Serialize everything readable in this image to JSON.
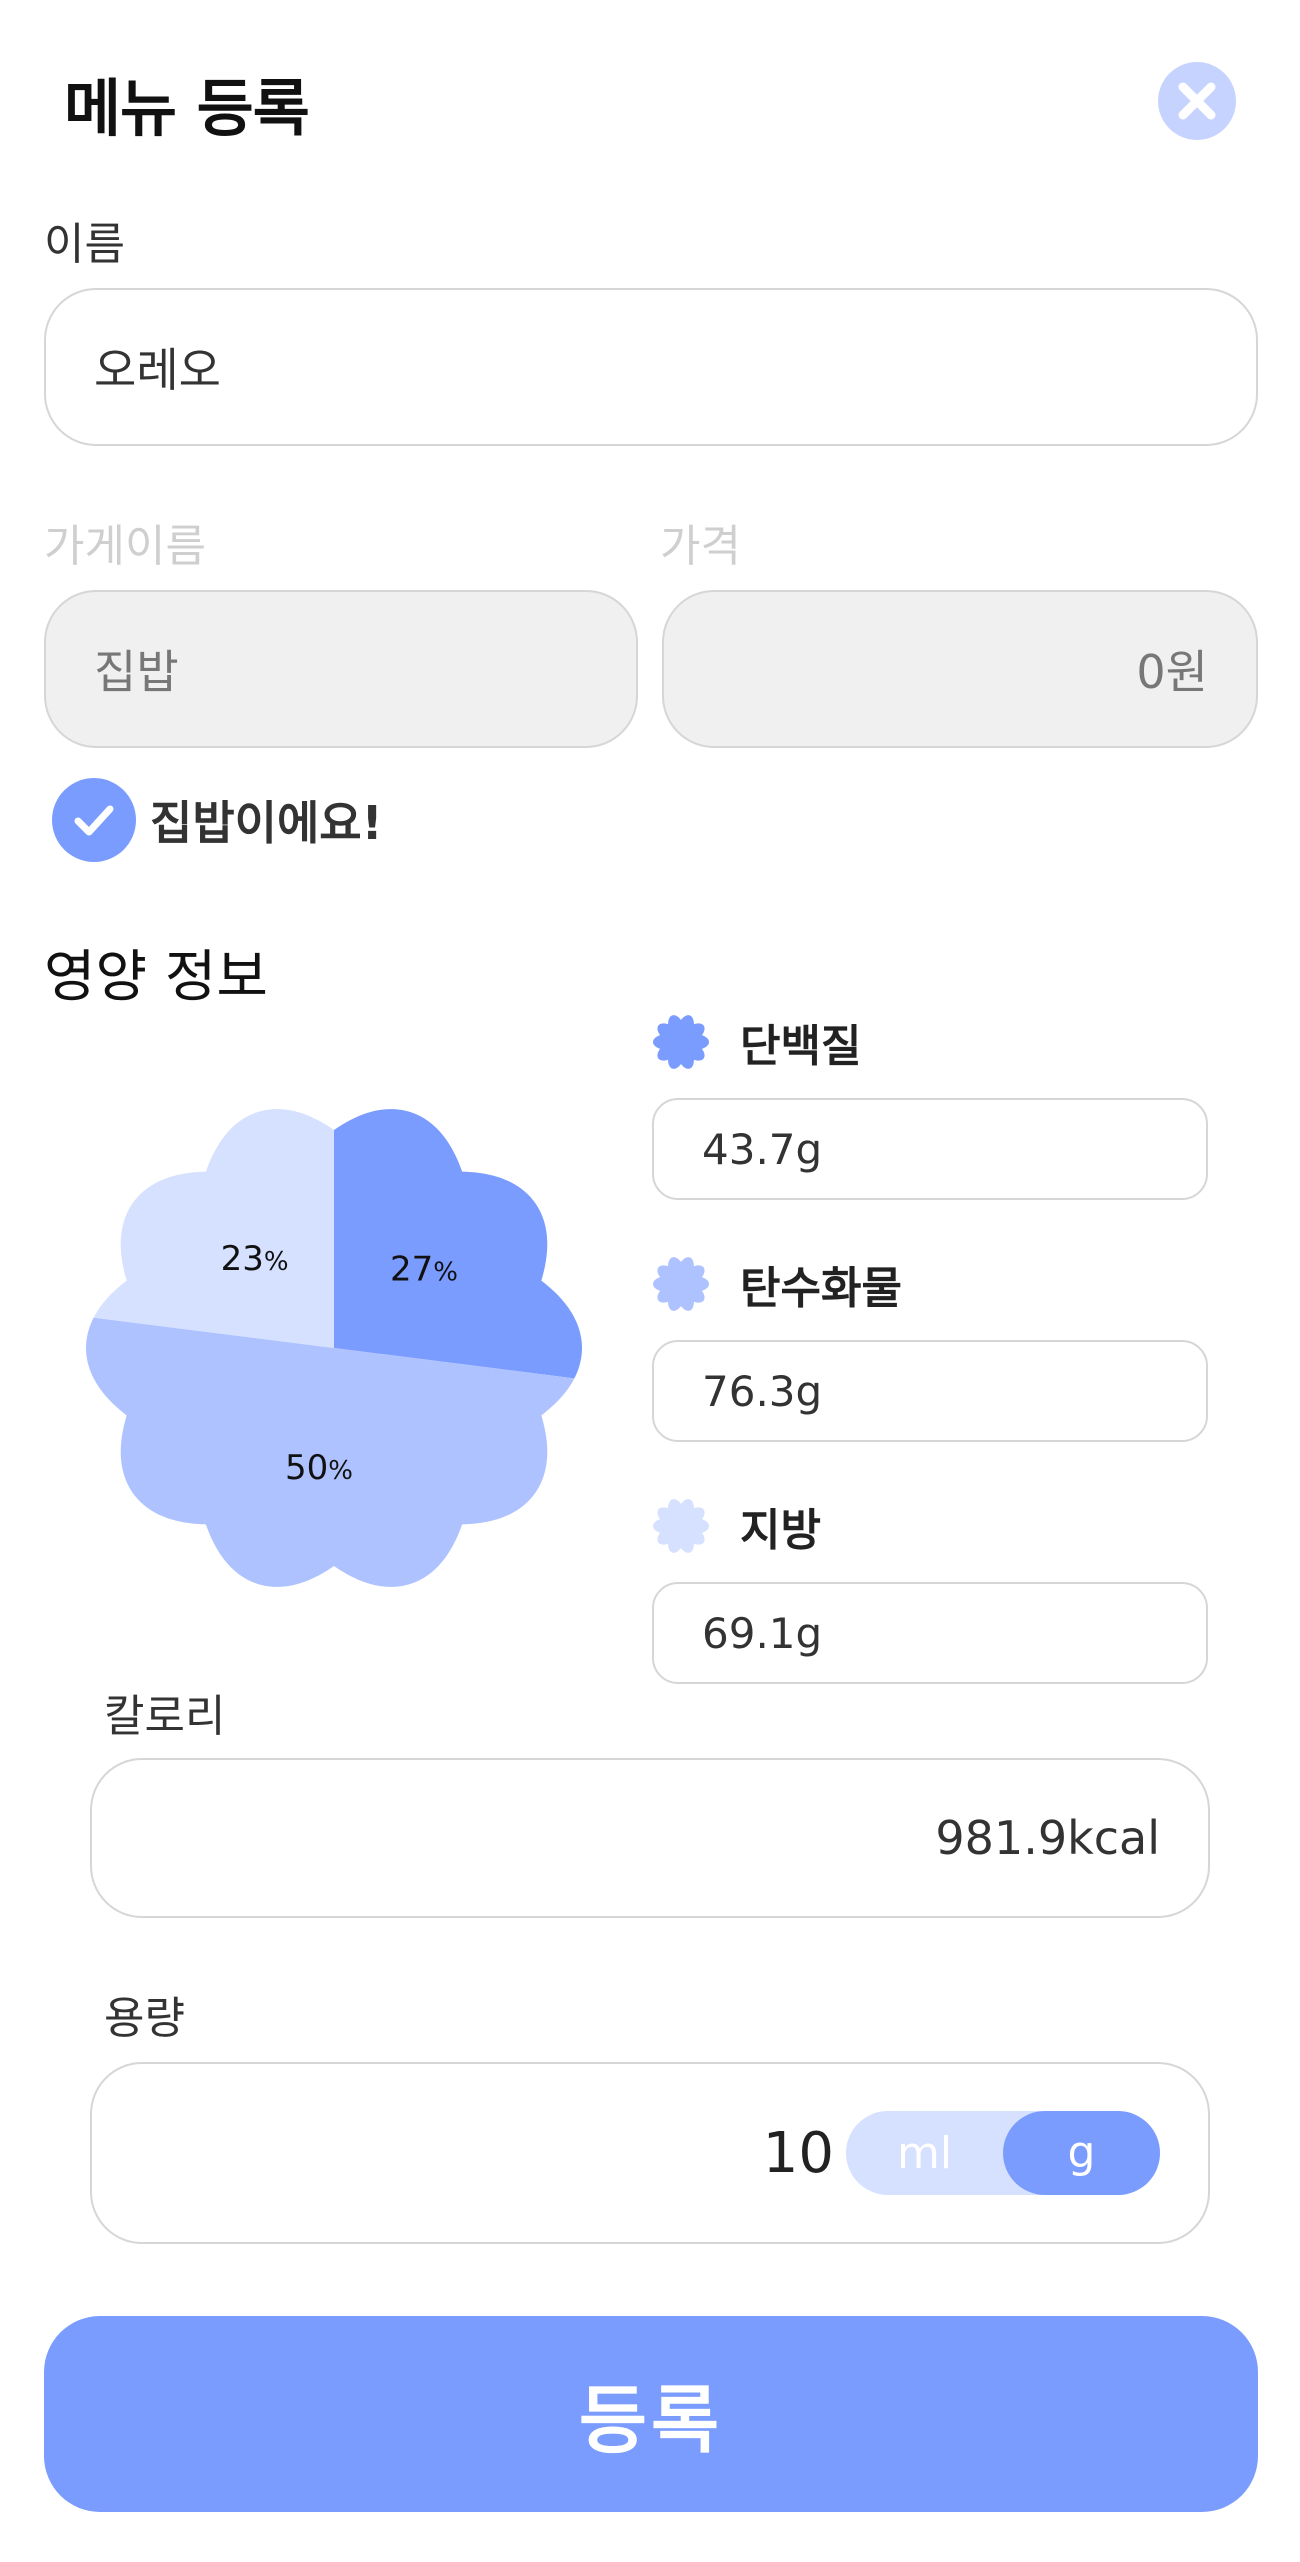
{
  "header": {
    "title": "메뉴 등록",
    "close_icon": "close-icon"
  },
  "name_field": {
    "label": "이름",
    "value": "오레오"
  },
  "store_field": {
    "label": "가게이름",
    "value": "집밥"
  },
  "price_field": {
    "label": "가격",
    "value": "0원"
  },
  "homemade_check": {
    "label": "집밥이에요!",
    "checked": true
  },
  "nutrition": {
    "title": "영양 정보",
    "protein": {
      "label": "단백질",
      "value": "43.7g",
      "color": "#7b9cff"
    },
    "carbs": {
      "label": "탄수화물",
      "value": "76.3g",
      "color": "#aec2ff"
    },
    "fat": {
      "label": "지방",
      "value": "69.1g",
      "color": "#d6e0ff"
    }
  },
  "chart_data": {
    "type": "pie",
    "slices": [
      {
        "name": "단백질",
        "value": 27,
        "label": "27",
        "unit": "%",
        "color": "#7b9cff"
      },
      {
        "name": "탄수화물",
        "value": 50,
        "label": "50",
        "unit": "%",
        "color": "#aec2ff"
      },
      {
        "name": "지방",
        "value": 23,
        "label": "23",
        "unit": "%",
        "color": "#d6e0ff"
      }
    ]
  },
  "calorie_field": {
    "label": "칼로리",
    "value": "981.9kcal"
  },
  "amount_field": {
    "label": "용량",
    "value": "10",
    "units": [
      "ml",
      "g"
    ],
    "selected_unit": "g"
  },
  "submit": {
    "label": "등록"
  }
}
